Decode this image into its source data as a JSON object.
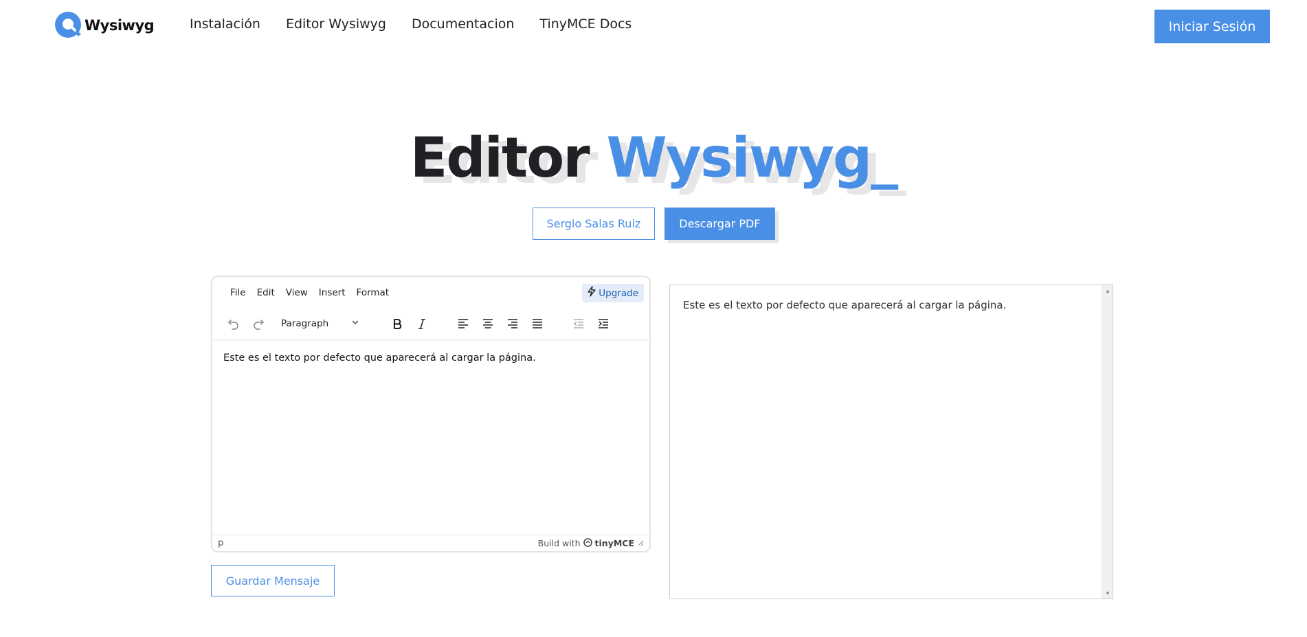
{
  "brand": {
    "name": "Wysiwyg"
  },
  "nav": {
    "links": [
      "Instalación",
      "Editor Wysiwyg",
      "Documentacion",
      "TinyMCE Docs"
    ],
    "login_label": "Iniciar Sesión"
  },
  "hero": {
    "title_dark": "Editor",
    "title_blue": "Wysiwyg_",
    "author_label": "Sergio Salas Ruiz",
    "download_label": "Descargar PDF"
  },
  "editor": {
    "menu": [
      "File",
      "Edit",
      "View",
      "Insert",
      "Format"
    ],
    "upgrade_label": "Upgrade",
    "block_format": "Paragraph",
    "content": "Este es el texto por defecto que aparecerá al cargar la página.",
    "status_path": "p",
    "branding_prefix": "Build with",
    "branding_name": "tinyMCE"
  },
  "save_label": "Guardar Mensaje",
  "preview": {
    "text": "Este es el texto por defecto que aparecerá al cargar la página."
  },
  "colors": {
    "accent": "#4a8fe6",
    "dark": "#202124"
  }
}
